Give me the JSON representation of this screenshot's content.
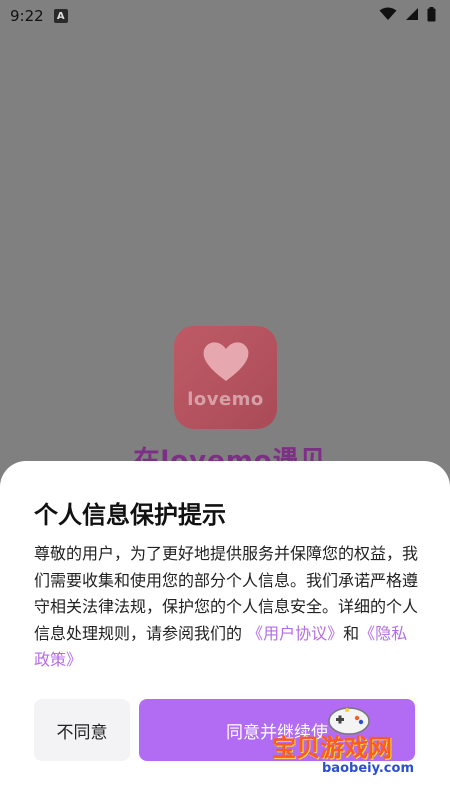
{
  "status_bar": {
    "time": "9:22",
    "notification_badge": "A"
  },
  "splash": {
    "logo_text": "lovemo",
    "title": "在lovemo遇见"
  },
  "dialog": {
    "title": "个人信息保护提示",
    "body_text": "尊敬的用户，为了更好地提供服务并保障您的权益，我们需要收集和使用您的部分个人信息。我们承诺严格遵守相关法律法规，保护您的个人信息安全。详细的个人信息处理规则，请参阅我们的",
    "user_agreement_link": "《用户协议》",
    "and_text": "和",
    "privacy_policy_link": "《隐私政策》",
    "decline_label": "不同意",
    "accept_label": "同意并继续使"
  },
  "watermark": {
    "text": "宝贝游戏网",
    "url": "baobeiy.com"
  },
  "colors": {
    "overlay": "#808080",
    "accent": "#b26cf3",
    "link": "#b56ee8",
    "logo_bg": "#bd5a66"
  }
}
